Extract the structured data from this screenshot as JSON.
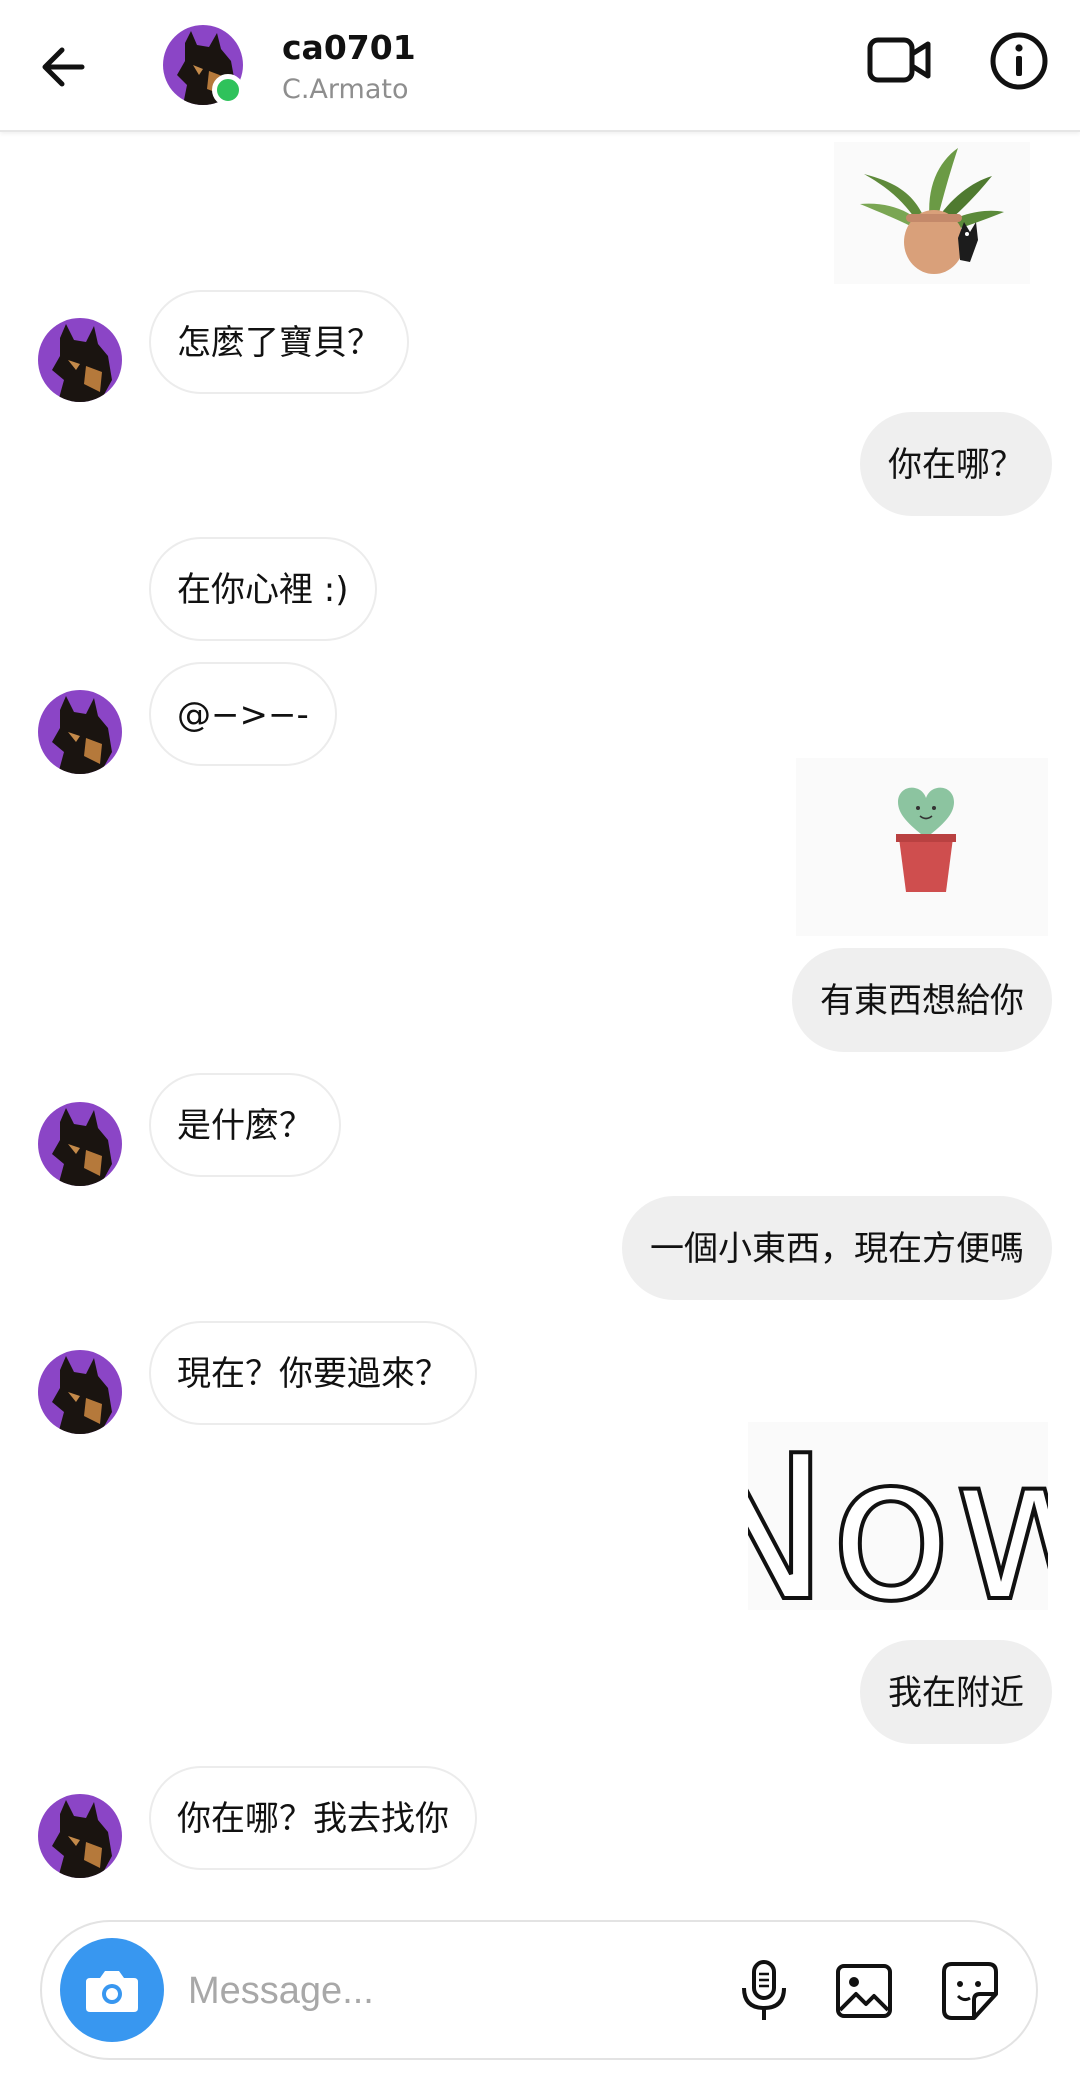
{
  "header": {
    "username": "ca0701",
    "full_name": "C.Armato",
    "status": "online"
  },
  "messages": [
    {
      "from": "me",
      "type": "sticker",
      "sticker": "potted-plant-with-cat"
    },
    {
      "from": "them",
      "type": "text",
      "text": "怎麼了寶貝？"
    },
    {
      "from": "me",
      "type": "text",
      "text": "你在哪？"
    },
    {
      "from": "them",
      "type": "text",
      "text": "在你心裡 :)"
    },
    {
      "from": "them",
      "type": "text",
      "text": "@−>−-"
    },
    {
      "from": "me",
      "type": "sticker",
      "sticker": "heart-cactus-pot"
    },
    {
      "from": "me",
      "type": "text",
      "text": "有東西想給你"
    },
    {
      "from": "them",
      "type": "text",
      "text": "是什麼？"
    },
    {
      "from": "me",
      "type": "text",
      "text": "一個小東西，現在方便嗎"
    },
    {
      "from": "them",
      "type": "text",
      "text": "現在？你要過來？"
    },
    {
      "from": "me",
      "type": "sticker",
      "sticker": "now-lettering",
      "text": "Now"
    },
    {
      "from": "me",
      "type": "text",
      "text": "我在附近"
    },
    {
      "from": "them",
      "type": "text",
      "text": "你在哪？我去找你"
    }
  ],
  "composer": {
    "placeholder": "Message..."
  },
  "icons": {
    "back": "arrow-left-icon",
    "video": "video-call-icon",
    "info": "info-icon",
    "camera": "camera-icon",
    "mic": "microphone-icon",
    "gallery": "image-icon",
    "sticker": "sticker-icon"
  },
  "colors": {
    "avatar_bg": "#8b45c6",
    "online": "#2fc25b",
    "camera_button": "#3897f0",
    "outgoing_bubble": "#efefef",
    "incoming_border": "#ececec"
  }
}
